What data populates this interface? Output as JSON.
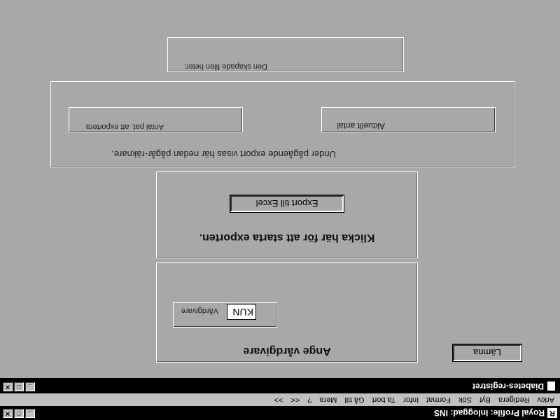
{
  "app": {
    "title": "Royal Profile: Inloggad:  INS",
    "icon": "royal-profile-icon"
  },
  "menu": [
    "Arkiv",
    "Redigera",
    "Byt",
    "Sök",
    "Format",
    "Infor",
    "Ta bort",
    "Gå till",
    "Mera",
    "?",
    "<<",
    ">>"
  ],
  "window": {
    "title": "Diabetes-registret"
  },
  "vardgivare": {
    "heading": "Ange vårdgivare",
    "label": "Vårdgivare",
    "value": "KUN"
  },
  "export": {
    "instruction": "Klicka här för att starta exporten.",
    "button_label": "Export till Excel"
  },
  "progress": {
    "info": "Under pågående export visas   här nedan pågår-räknare.",
    "count_label": "Antal pat. att exportera",
    "current_label": "Aktuellt antal"
  },
  "file": {
    "label": "Den skapade filen heter:"
  },
  "lamna_button": "Lämna",
  "window_buttons": {
    "minimize": "_",
    "maximize": "□",
    "close": "✕"
  }
}
